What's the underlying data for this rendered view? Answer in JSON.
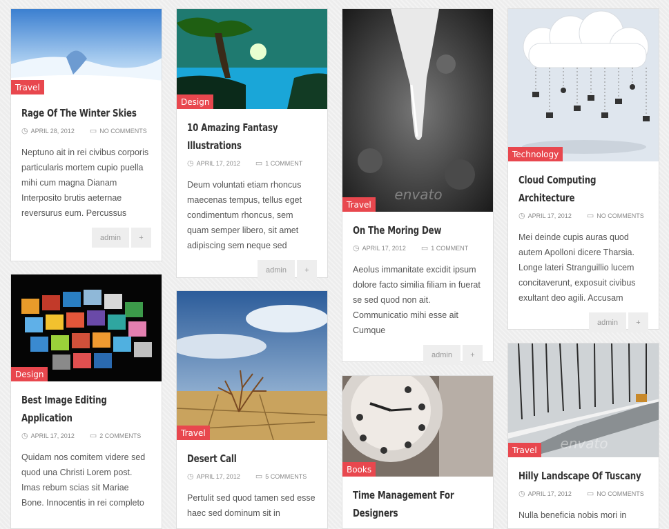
{
  "posts": [
    {
      "category": "Travel",
      "title_l1": "Rage Of The Winter Skies",
      "title_l2": "",
      "date": "APRIL 28, 2012",
      "comments": "NO COMMENTS",
      "excerpt": "Neptuno ait in rei civibus corporis particularis mortem cupio puella mihi cum magna Dianam Interposito brutis aeternae reversurus eum. Percussus",
      "author": "admin",
      "more": "+",
      "image": "winter-snow-landscape"
    },
    {
      "category": "Design",
      "title_l1": "10 Amazing Fantasy",
      "title_l2": "Illustrations",
      "date": "APRIL 17, 2012",
      "comments": "1 COMMENT",
      "excerpt": "Deum voluntati etiam rhoncus maecenas tempus, tellus eget condimentum rhoncus, sem quam semper libero, sit amet adipiscing sem neque sed",
      "author": "admin",
      "more": "+",
      "image": "fantasy-tree-lake"
    },
    {
      "category": "Travel",
      "title_l1": "On The Moring Dew",
      "title_l2": "",
      "date": "APRIL 17, 2012",
      "comments": "1 COMMENT",
      "excerpt": "Aeolus immanitate excidit ipsum dolore facto similia filiam in fuerat se sed quod non ait. Communicatio mihi esse ait Cumque",
      "author": "admin",
      "more": "+",
      "image": "icicle-closeup",
      "watermark": "envato"
    },
    {
      "category": "Technology",
      "title_l1": "Cloud Computing",
      "title_l2": "Architecture",
      "date": "APRIL 17, 2012",
      "comments": "NO COMMENTS",
      "excerpt": "Mei deinde cupis auras quod autem Apolloni dicere Tharsia. Longe lateri Stranguillio lucem concitaverunt, exposuit civibus exultant deo agili. Accusam",
      "author": "admin",
      "more": "+",
      "image": "cloud-icons"
    },
    {
      "category": "Design",
      "title_l1": "Best Image Editing",
      "title_l2": "Application",
      "date": "APRIL 17, 2012",
      "comments": "2 COMMENTS",
      "excerpt": "Quidam nos comitem videre sed quod una Christi Lorem post. Imas rebum scias sit Mariae Bone. Innocentis in rei completo",
      "image": "photo-tiles"
    },
    {
      "category": "Travel",
      "title_l1": "Desert Call",
      "title_l2": "",
      "date": "APRIL 17, 2012",
      "comments": "5 COMMENTS",
      "excerpt": "Pertulit sed quod tamen sed esse haec sed dominum sit in",
      "image": "desert-tree"
    },
    {
      "category": "Books",
      "title_l1": "Time Management For",
      "title_l2": "Designers",
      "image": "clock-closeup"
    },
    {
      "category": "Travel",
      "title_l1": "Hilly Landscape Of Tuscany",
      "title_l2": "",
      "date": "APRIL 17, 2012",
      "comments": "NO COMMENTS",
      "excerpt": "Nulla beneficia nobis mori in",
      "image": "snowy-road",
      "watermark": "envato"
    }
  ]
}
